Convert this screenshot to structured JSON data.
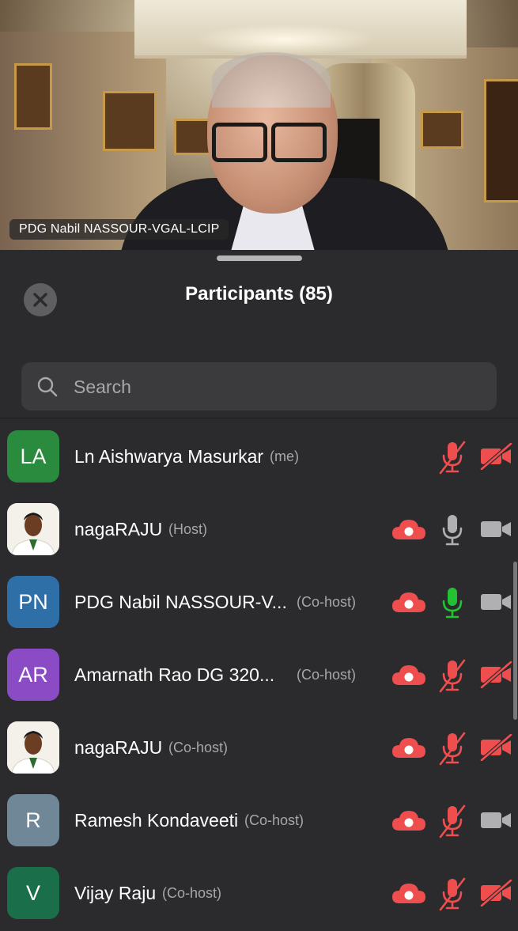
{
  "video": {
    "speaker_name": "PDG Nabil NASSOUR-VGAL-LCIP"
  },
  "panel": {
    "title": "Participants (85)",
    "search_placeholder": "Search"
  },
  "colors": {
    "sheet_bg": "#2b2b2d",
    "muted_red": "#ef4e4e",
    "active_green": "#22c232",
    "icon_gray": "#b0b0b3"
  },
  "participants": [
    {
      "initials": "LA",
      "name": "Ln Aishwarya Masurkar",
      "role": "(me)",
      "avatar_color": "#2a8a3e",
      "avatar_type": "initials",
      "recording": false,
      "mic": "muted",
      "camera": "off"
    },
    {
      "initials": "",
      "name": "nagaRAJU",
      "role": "(Host)",
      "avatar_color": "#f4f0ea",
      "avatar_type": "photo",
      "recording": true,
      "mic": "idle",
      "camera": "on"
    },
    {
      "initials": "PN",
      "name": "PDG Nabil NASSOUR-V...",
      "role": "(Co-host)",
      "avatar_color": "#2e6fa8",
      "avatar_type": "initials",
      "recording": true,
      "mic": "active",
      "camera": "on"
    },
    {
      "initials": "AR",
      "name": "Amarnath Rao DG 320...",
      "role": "(Co-host)",
      "avatar_color": "#8a4bc4",
      "avatar_type": "initials",
      "recording": true,
      "mic": "muted",
      "camera": "off"
    },
    {
      "initials": "",
      "name": "nagaRAJU",
      "role": "(Co-host)",
      "avatar_color": "#f4f0ea",
      "avatar_type": "photo",
      "recording": true,
      "mic": "muted",
      "camera": "off"
    },
    {
      "initials": "R",
      "name": "Ramesh Kondaveeti",
      "role": "(Co-host)",
      "avatar_color": "#6f8796",
      "avatar_type": "initials",
      "recording": true,
      "mic": "muted",
      "camera": "on"
    },
    {
      "initials": "V",
      "name": "Vijay Raju",
      "role": "(Co-host)",
      "avatar_color": "#1b6e4a",
      "avatar_type": "initials",
      "recording": true,
      "mic": "muted",
      "camera": "off"
    }
  ]
}
